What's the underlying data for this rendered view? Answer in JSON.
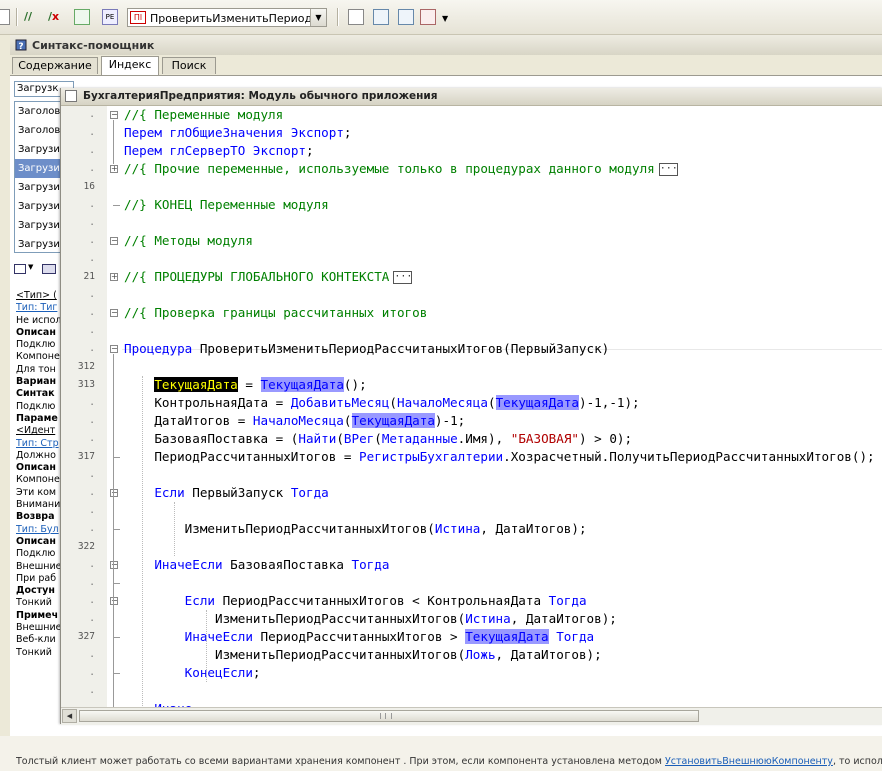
{
  "toolbar": {
    "procedure_selector": "ПроверитьИзменитьПериодРас"
  },
  "helper": {
    "title": "Синтакс-помощник",
    "tabs": [
      "Содержание",
      "Индекс",
      "Поиск"
    ],
    "active_tab": "Индекс",
    "index_search": "Загрузк",
    "index_items": [
      {
        "label": "Заголов",
        "selected": false
      },
      {
        "label": "Заголов",
        "selected": false
      },
      {
        "label": "Загрузи",
        "selected": false
      },
      {
        "label": "Загрузи",
        "selected": true
      },
      {
        "label": "Загрузи",
        "selected": false
      },
      {
        "label": "Загрузи",
        "selected": false
      },
      {
        "label": "Загрузи",
        "selected": false
      },
      {
        "label": "Загрузи",
        "selected": false
      }
    ],
    "description_lines": [
      {
        "text": "<Тип> (",
        "style": "u"
      },
      {
        "text": "Тип: Тиг",
        "style": "lnk"
      },
      {
        "text": "Не испол",
        "style": ""
      },
      {
        "text": "Описан",
        "style": "b"
      },
      {
        "text": "Подклю",
        "style": ""
      },
      {
        "text": "Компоне",
        "style": ""
      },
      {
        "text": "Для тон",
        "style": ""
      },
      {
        "text": "Вариан",
        "style": "b"
      },
      {
        "text": "Синтак",
        "style": "b"
      },
      {
        "text": "Подклю",
        "style": ""
      },
      {
        "text": "Параме",
        "style": "b"
      },
      {
        "text": "<Идент",
        "style": "u"
      },
      {
        "text": "Тип: Стр",
        "style": "lnk"
      },
      {
        "text": "Должно",
        "style": ""
      },
      {
        "text": "Описан",
        "style": "b"
      },
      {
        "text": "Компоне",
        "style": ""
      },
      {
        "text": "Эти ком",
        "style": ""
      },
      {
        "text": "Внимани",
        "style": ""
      },
      {
        "text": "Возвра",
        "style": "b"
      },
      {
        "text": "Тип: Бул",
        "style": "lnk"
      },
      {
        "text": "Описан",
        "style": "b"
      },
      {
        "text": "Подклю",
        "style": ""
      },
      {
        "text": "Внешние",
        "style": ""
      },
      {
        "text": "При раб",
        "style": ""
      },
      {
        "text": "Достун",
        "style": "b"
      },
      {
        "text": "Тонкий",
        "style": ""
      },
      {
        "text": "Примеч",
        "style": "b"
      },
      {
        "text": "Внешние",
        "style": ""
      },
      {
        "text": "Веб-кли",
        "style": ""
      },
      {
        "text": "Тонкий",
        "style": ""
      }
    ],
    "bottom_text": "Толстый клиент может работать со всеми вариантами хранения компонент . При этом, если компонента установлена методом ",
    "bottom_link": "УстановитьВнешнююКомпоненту",
    "bottom_tail": ", то использ"
  },
  "module": {
    "title": "БухгалтерияПредприятия: Модуль обычного приложения",
    "collapsed_marker": "···",
    "line_numbers": [
      ".",
      ".",
      ".",
      ".",
      "16",
      ".",
      ".",
      ".",
      ".",
      "21",
      ".",
      ".",
      ".",
      ".",
      "312",
      "313",
      ".",
      ".",
      ".",
      "317",
      ".",
      ".",
      ".",
      ".",
      "322",
      ".",
      ".",
      ".",
      ".",
      "327",
      ".",
      ".",
      ".",
      "."
    ],
    "code_lines": [
      [
        {
          "t": "//{ Переменные модуля",
          "c": "cm"
        }
      ],
      [
        {
          "t": "Перем ",
          "c": "kw"
        },
        {
          "t": "глОбщиеЗначения ",
          "c": "kw"
        },
        {
          "t": "Экспорт",
          "c": "kw"
        },
        {
          "t": ";",
          "c": ""
        }
      ],
      [
        {
          "t": "Перем ",
          "c": "kw"
        },
        {
          "t": "глСерверТО ",
          "c": "kw"
        },
        {
          "t": "Экспорт",
          "c": "kw"
        },
        {
          "t": ";",
          "c": ""
        }
      ],
      [
        {
          "t": "//{ Прочие переменные, используемые только в процедурах данного модуля",
          "c": "cm"
        }
      ],
      [],
      [
        {
          "t": "//} КОНЕЦ Переменные модуля",
          "c": "cm"
        }
      ],
      [],
      [
        {
          "t": "//{ Методы модуля",
          "c": "cm"
        }
      ],
      [],
      [
        {
          "t": "//{ ПРОЦЕДУРЫ ГЛОБАЛЬНОГО КОНТЕКСТА",
          "c": "cm"
        }
      ],
      [],
      [
        {
          "t": "//{ Проверка границы рассчитанных итогов",
          "c": "cm"
        }
      ],
      [],
      [
        {
          "t": "Процедура ",
          "c": "kw"
        },
        {
          "t": "ПроверитьИзменитьПериодРассчитаныхИтогов(ПервыйЗапуск)",
          "c": ""
        }
      ],
      [],
      [
        {
          "t": "    ",
          "c": ""
        },
        {
          "t": "ТекущаяДата",
          "c": "hl2"
        },
        {
          "t": " = ",
          "c": ""
        },
        {
          "t": "ТекущаяДата",
          "c": "hl kw"
        },
        {
          "t": "();",
          "c": ""
        }
      ],
      [
        {
          "t": "    КонтрольнаяДата = ",
          "c": ""
        },
        {
          "t": "ДобавитьМесяц",
          "c": "kw"
        },
        {
          "t": "(",
          "c": ""
        },
        {
          "t": "НачалоМесяца",
          "c": "kw"
        },
        {
          "t": "(",
          "c": ""
        },
        {
          "t": "ТекущаяДата",
          "c": "hl kw"
        },
        {
          "t": ")-1,-1);",
          "c": ""
        }
      ],
      [
        {
          "t": "    ДатаИтогов = ",
          "c": ""
        },
        {
          "t": "НачалоМесяца",
          "c": "kw"
        },
        {
          "t": "(",
          "c": ""
        },
        {
          "t": "ТекущаяДата",
          "c": "hl kw"
        },
        {
          "t": ")-1;",
          "c": ""
        }
      ],
      [
        {
          "t": "    БазоваяПоставка = (",
          "c": ""
        },
        {
          "t": "Найти",
          "c": "kw"
        },
        {
          "t": "(",
          "c": ""
        },
        {
          "t": "ВРег",
          "c": "kw"
        },
        {
          "t": "(",
          "c": ""
        },
        {
          "t": "Метаданные",
          "c": "kw"
        },
        {
          "t": ".Имя), ",
          "c": ""
        },
        {
          "t": "\"БАЗОВАЯ\"",
          "c": "st"
        },
        {
          "t": ") > 0);",
          "c": ""
        }
      ],
      [
        {
          "t": "    ПериодРассчитанныхИтогов = ",
          "c": ""
        },
        {
          "t": "РегистрыБухгалтерии",
          "c": "kw"
        },
        {
          "t": ".Хозрасчетный.ПолучитьПериодРассчитанныхИтогов();",
          "c": ""
        }
      ],
      [],
      [
        {
          "t": "    ",
          "c": ""
        },
        {
          "t": "Если ",
          "c": "kw"
        },
        {
          "t": "ПервыйЗапуск ",
          "c": ""
        },
        {
          "t": "Тогда",
          "c": "kw"
        }
      ],
      [],
      [
        {
          "t": "        ИзменитьПериодРассчитанныхИтогов(",
          "c": ""
        },
        {
          "t": "Истина",
          "c": "kw"
        },
        {
          "t": ", ДатаИтогов);",
          "c": ""
        }
      ],
      [],
      [
        {
          "t": "    ",
          "c": ""
        },
        {
          "t": "ИначеЕсли ",
          "c": "kw"
        },
        {
          "t": "БазоваяПоставка ",
          "c": ""
        },
        {
          "t": "Тогда",
          "c": "kw"
        }
      ],
      [],
      [
        {
          "t": "        ",
          "c": ""
        },
        {
          "t": "Если ",
          "c": "kw"
        },
        {
          "t": "ПериодРассчитанныхИтогов < КонтрольнаяДата ",
          "c": ""
        },
        {
          "t": "Тогда",
          "c": "kw"
        }
      ],
      [
        {
          "t": "            ИзменитьПериодРассчитанныхИтогов(",
          "c": ""
        },
        {
          "t": "Истина",
          "c": "kw"
        },
        {
          "t": ", ДатаИтогов);",
          "c": ""
        }
      ],
      [
        {
          "t": "        ",
          "c": ""
        },
        {
          "t": "ИначеЕсли ",
          "c": "kw"
        },
        {
          "t": "ПериодРассчитанныхИтогов > ",
          "c": ""
        },
        {
          "t": "ТекущаяДата",
          "c": "hl kw"
        },
        {
          "t": " ",
          "c": ""
        },
        {
          "t": "Тогда",
          "c": "kw"
        }
      ],
      [
        {
          "t": "            ИзменитьПериодРассчитанныхИтогов(",
          "c": ""
        },
        {
          "t": "Ложь",
          "c": "kw"
        },
        {
          "t": ", ДатаИтогов);",
          "c": ""
        }
      ],
      [
        {
          "t": "        ",
          "c": ""
        },
        {
          "t": "КонецЕсли",
          "c": "kw"
        },
        {
          "t": ";",
          "c": ""
        }
      ],
      [],
      [
        {
          "t": "    ",
          "c": ""
        },
        {
          "t": "Иначе",
          "c": "kw"
        }
      ]
    ]
  }
}
